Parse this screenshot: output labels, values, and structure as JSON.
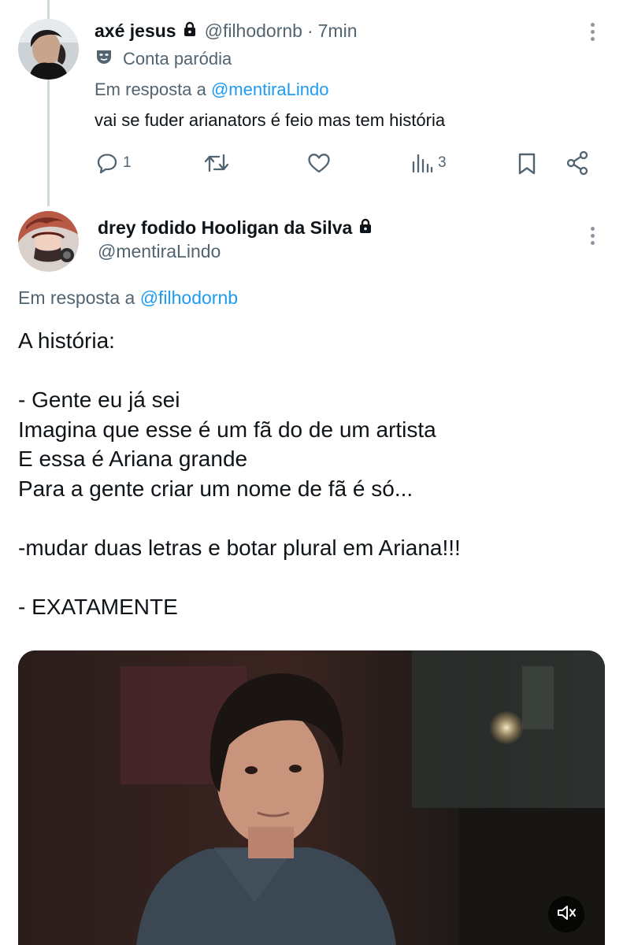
{
  "thread": {
    "tweet1": {
      "display_name": "axé jesus",
      "handle": "@filhodornb",
      "separator": "·",
      "time": "7min",
      "parody_label": "Conta paródia",
      "reply_prefix": "Em resposta a",
      "reply_to": "@mentiraLindo",
      "text": "vai se fuder arianators é feio mas tem história",
      "actions": {
        "replies": "1",
        "reposts": "",
        "likes": "",
        "views": "3"
      },
      "icons": [
        "lock-icon",
        "mask-icon",
        "reply-icon",
        "repost-icon",
        "like-icon",
        "views-icon",
        "bookmark-icon",
        "share-icon",
        "more-icon"
      ]
    },
    "tweet2": {
      "display_name": "drey fodido Hooligan da Silva",
      "handle": "@mentiraLindo",
      "reply_prefix": "Em resposta a",
      "reply_to": "@filhodornb",
      "body_lines": [
        "A história:",
        "",
        "- Gente eu já sei",
        "Imagina que esse é um fã do de um artista",
        "E essa é Ariana grande",
        "Para a gente criar um nome de fã é só...",
        "",
        "-mudar duas letras e botar plural em Ariana!!!",
        "",
        "- EXATAMENTE"
      ],
      "media": {
        "type": "video",
        "sound_icon": "volume-icon"
      }
    }
  },
  "colors": {
    "text": "#0f1419",
    "muted": "#536471",
    "link": "#1d9bf0",
    "thread_line": "#cfd9de"
  }
}
